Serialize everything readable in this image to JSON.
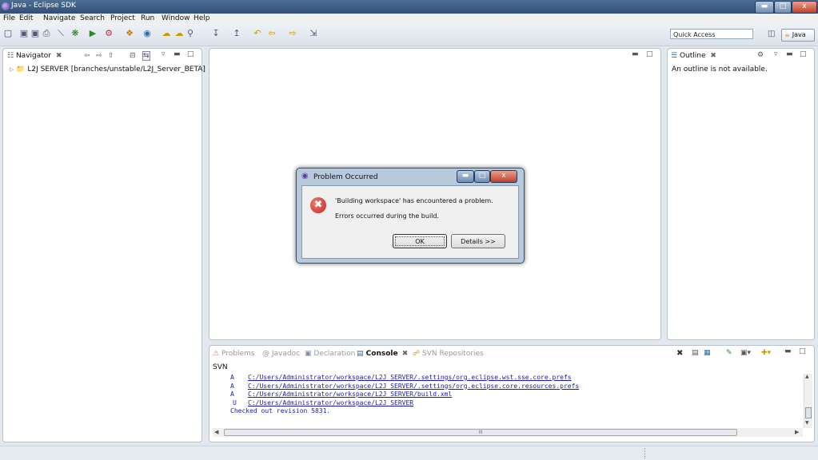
{
  "window": {
    "title": "Java - Eclipse SDK",
    "minimize_icon": "minimize-icon",
    "maximize_icon": "maximize-icon",
    "close_label": "x"
  },
  "menu": [
    "File",
    "Edit",
    "Navigate",
    "Search",
    "Project",
    "Run",
    "Window",
    "Help"
  ],
  "toolbar": {
    "quick_access_placeholder": "Quick Access",
    "perspective_label": "Java"
  },
  "navigator": {
    "tab_label": "Navigator",
    "tree_item": "L2J SERVER [branches/unstable/L2J_Server_BETA]"
  },
  "outline": {
    "tab_label": "Outline",
    "message": "An outline is not available."
  },
  "bottom_panel": {
    "tabs": [
      "Problems",
      "@ Javadoc",
      "Declaration",
      "Console",
      "SVN Repositories"
    ],
    "active_tab": "Console",
    "console_name": "SVN",
    "lines": [
      {
        "status": "A",
        "path": "C:/Users/Administrator/workspace/L2J SERVER/.settings/org.eclipse.wst.sse.core.prefs"
      },
      {
        "status": "A",
        "path": "C:/Users/Administrator/workspace/L2J SERVER/.settings/org.eclipse.core.resources.prefs"
      },
      {
        "status": "A",
        "path": "C:/Users/Administrator/workspace/L2J SERVER/build.xml"
      },
      {
        "status": "U",
        "path": "C:/Users/Administrator/workspace/L2J SERVER"
      }
    ],
    "footer_line": "Checked out revision 5831.",
    "hscroll_label": "III"
  },
  "dialog": {
    "title": "Problem Occurred",
    "message": "'Building workspace' has encountered a problem.",
    "detail": "Errors occurred during the build.",
    "ok_label": "OK",
    "details_label": "Details >>",
    "close_label": "x"
  },
  "colors": {
    "accent": "#2f4f77",
    "error": "#c62828",
    "link": "#1a1aa6"
  }
}
